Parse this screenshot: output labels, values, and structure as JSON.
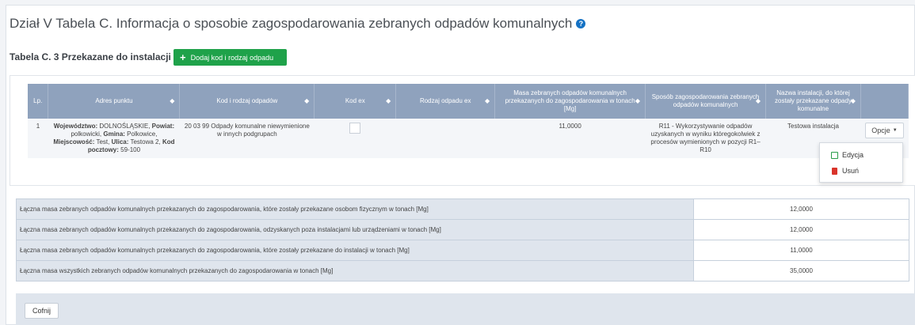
{
  "header": {
    "title": "Dział V Tabela C. Informacja o sposobie zagospodarowania zebranych odpadów komunalnych",
    "help_icon": "question-circle-icon"
  },
  "section": {
    "title": "Tabela C. 3 Przekazane do instalacji",
    "add_button_label": "Dodaj kod i rodzaj odpadu"
  },
  "table": {
    "columns": [
      "Lp.",
      "Adres punktu",
      "Kod i rodzaj odpadów",
      "Kod ex",
      "Rodzaj odpadu ex",
      "Masa zebranych odpadów komunalnych przekazanych do zagospodarowania w tonach [Mg]",
      "Sposób zagospodarowania zebranych odpadów komunalnych",
      "Nazwa instalacji, do której zostały przekazane odpady komunalne"
    ],
    "rows": [
      {
        "lp": "1",
        "address": {
          "wojewodztwo_label": "Województwo:",
          "wojewodztwo": "DOLNOŚLĄSKIE,",
          "powiat_label": "Powiat:",
          "powiat": "polkowicki,",
          "gmina_label": "Gmina:",
          "gmina": "Polkowice,",
          "miejscowosc_label": "Miejscowość:",
          "miejscowosc": "Test,",
          "ulica_label": "Ulica:",
          "ulica": "Testowa 2,",
          "kod_label": "Kod pocztowy:",
          "kod": "59-100"
        },
        "kod_rodzaj": "20 03 99 Odpady komunalne niewymienione w innych podgrupach",
        "kod_ex_checked": false,
        "rodzaj_ex": "",
        "masa": "11,0000",
        "sposob": "R11 - Wykorzystywanie odpadów uzyskanych w wyniku któregokolwiek z procesów wymienionych w pozycji R1–R10",
        "instalacja": "Testowa instalacja",
        "options_label": "Opcje"
      }
    ]
  },
  "dropdown": {
    "edit_label": "Edycja",
    "delete_label": "Usuń"
  },
  "summary": [
    {
      "label": "Łączna masa zebranych odpadów komunalnych przekazanych do zagospodarowania, które zostały przekazane osobom fizycznym w tonach [Mg]",
      "value": "12,0000"
    },
    {
      "label": "Łączna masa zebranych odpadów komunalnych przekazanych do zagospodarowania, odzyskanych poza instalacjami lub urządzeniami w tonach [Mg]",
      "value": "12,0000"
    },
    {
      "label": "Łączna masa zebranych odpadów komunalnych przekazanych do zagospodarowania, które zostały przekazane do instalacji w tonach [Mg]",
      "value": "11,0000"
    },
    {
      "label": "Łączna masa wszystkich zebranych odpadów komunalnych przekazanych do zagospodarowania w tonach [Mg]",
      "value": "35,0000"
    }
  ],
  "footer": {
    "back_label": "Cofnij"
  },
  "colors": {
    "header_blue": "#8fa2bd",
    "add_green": "#1fa24a",
    "help_blue": "#1572c4",
    "delete_red": "#d9342b"
  }
}
